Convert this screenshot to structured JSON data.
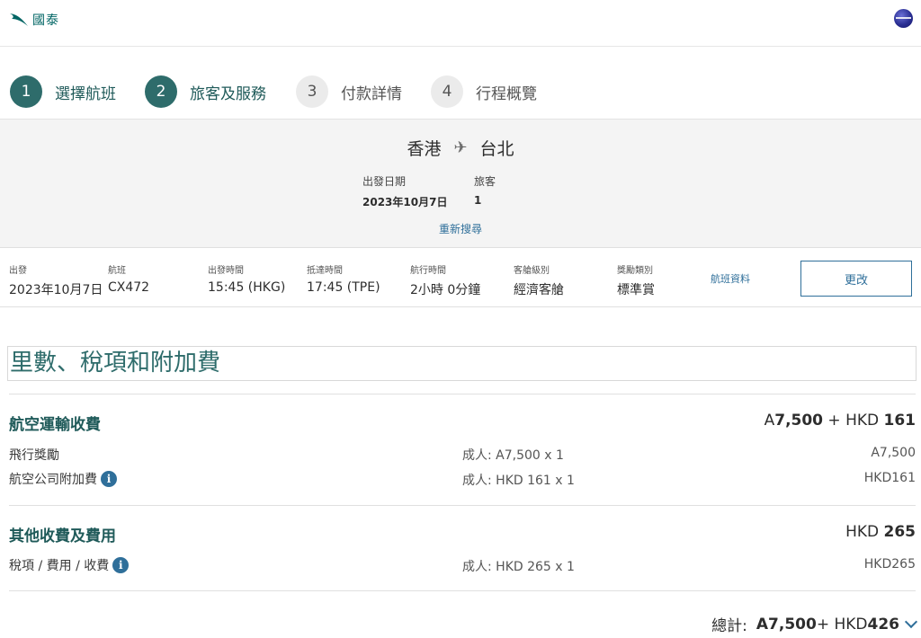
{
  "header": {
    "logo_text": "國泰",
    "logo_icon": "brushwing-logo-icon",
    "alliance_icon": "oneworld-globe-icon"
  },
  "steps": [
    {
      "num": "1",
      "label": "選擇航班",
      "state": "active"
    },
    {
      "num": "2",
      "label": "旅客及服務",
      "state": "active"
    },
    {
      "num": "3",
      "label": "付款詳情",
      "state": "inactive"
    },
    {
      "num": "4",
      "label": "行程概覽",
      "state": "inactive"
    }
  ],
  "route": {
    "origin": "香港",
    "destination": "台北",
    "date_label": "出發日期",
    "date_value": "2023年10月7日",
    "pax_label": "旅客",
    "pax_value": "1",
    "research_link": "重新搜尋"
  },
  "flight": {
    "depart_label": "出發",
    "depart_value": "2023年10月7日",
    "flight_label": "航班",
    "flight_value": "CX472",
    "dep_time_label": "出發時間",
    "dep_time_value": "15:45 (HKG)",
    "arr_time_label": "抵達時間",
    "arr_time_value": "17:45 (TPE)",
    "duration_label": "航行時間",
    "duration_value": "2小時 0分鐘",
    "cabin_label": "客艙級別",
    "cabin_value": "經濟客艙",
    "award_label": "獎勵類別",
    "award_value": "標準賞",
    "info_link": "航班資料",
    "change_button": "更改"
  },
  "fees": {
    "title": "里數、稅項和附加費",
    "air": {
      "heading": "航空運輸收費",
      "total_prefix": "A",
      "total_miles": "7,500",
      "total_mid": " + HKD ",
      "total_hkd": "161",
      "rows": [
        {
          "label": "飛行獎勵",
          "detail": "成人: A7,500 x 1",
          "amount": "A7,500"
        },
        {
          "label": "航空公司附加費",
          "detail": "成人: HKD 161 x 1",
          "amount": "HKD161"
        }
      ]
    },
    "other": {
      "heading": "其他收費及費用",
      "total_prefix": "HKD ",
      "total_hkd": "265",
      "rows": [
        {
          "label": "稅項 / 費用 / 收費",
          "detail": "成人: HKD 265 x 1",
          "amount": "HKD265"
        }
      ]
    },
    "grand": {
      "label": "總計:",
      "miles": "A7,500",
      "mid": " + HKD ",
      "hkd": "426"
    }
  },
  "colors": {
    "brand_teal": "#2e6c6b",
    "link_blue": "#2f6f9a"
  }
}
